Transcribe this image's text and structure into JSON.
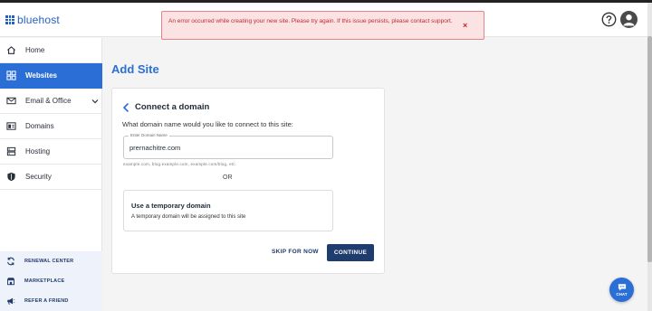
{
  "app": {
    "logo_text": "bluehost"
  },
  "alert": {
    "message": "An error occurred while creating your new site. Please try again. If this issue persists, please contact support.",
    "close_symbol": "×"
  },
  "header_icons": [
    "help-icon",
    "user-avatar-icon"
  ],
  "sidebar": {
    "items": [
      {
        "label": "Home",
        "icon": "home-icon"
      },
      {
        "label": "Websites",
        "icon": "websites-icon",
        "active": true
      },
      {
        "label": "Email & Office",
        "icon": "email-icon",
        "expandable": true
      },
      {
        "label": "Domains",
        "icon": "domains-icon"
      },
      {
        "label": "Hosting",
        "icon": "hosting-icon"
      },
      {
        "label": "Security",
        "icon": "shield-icon"
      }
    ],
    "bottom_links": [
      {
        "label": "RENEWAL CENTER",
        "icon": "renewal-icon"
      },
      {
        "label": "MARKETPLACE",
        "icon": "marketplace-icon"
      },
      {
        "label": "REFER A FRIEND",
        "icon": "megaphone-icon"
      }
    ]
  },
  "page": {
    "title": "Add Site"
  },
  "card": {
    "title": "Connect a domain",
    "question": "What domain name would you like to connect to this site:",
    "input": {
      "label": "Enter Domain Name",
      "value": "prernachitre.com"
    },
    "hint": "example.com, blog.example.com, example.com/blog, etc.",
    "or_text": "OR",
    "temp_domain": {
      "title": "Use a temporary domain",
      "description": "A temporary domain will be assigned to this site"
    },
    "skip_label": "SKIP FOR NOW",
    "continue_label": "CONTINUE"
  },
  "chat": {
    "label": "CHAT"
  },
  "colors": {
    "brand": "#2b6fd6",
    "primary_button": "#1e3c6e",
    "alert_bg": "#fbe3e4",
    "alert_text": "#c0272d"
  }
}
